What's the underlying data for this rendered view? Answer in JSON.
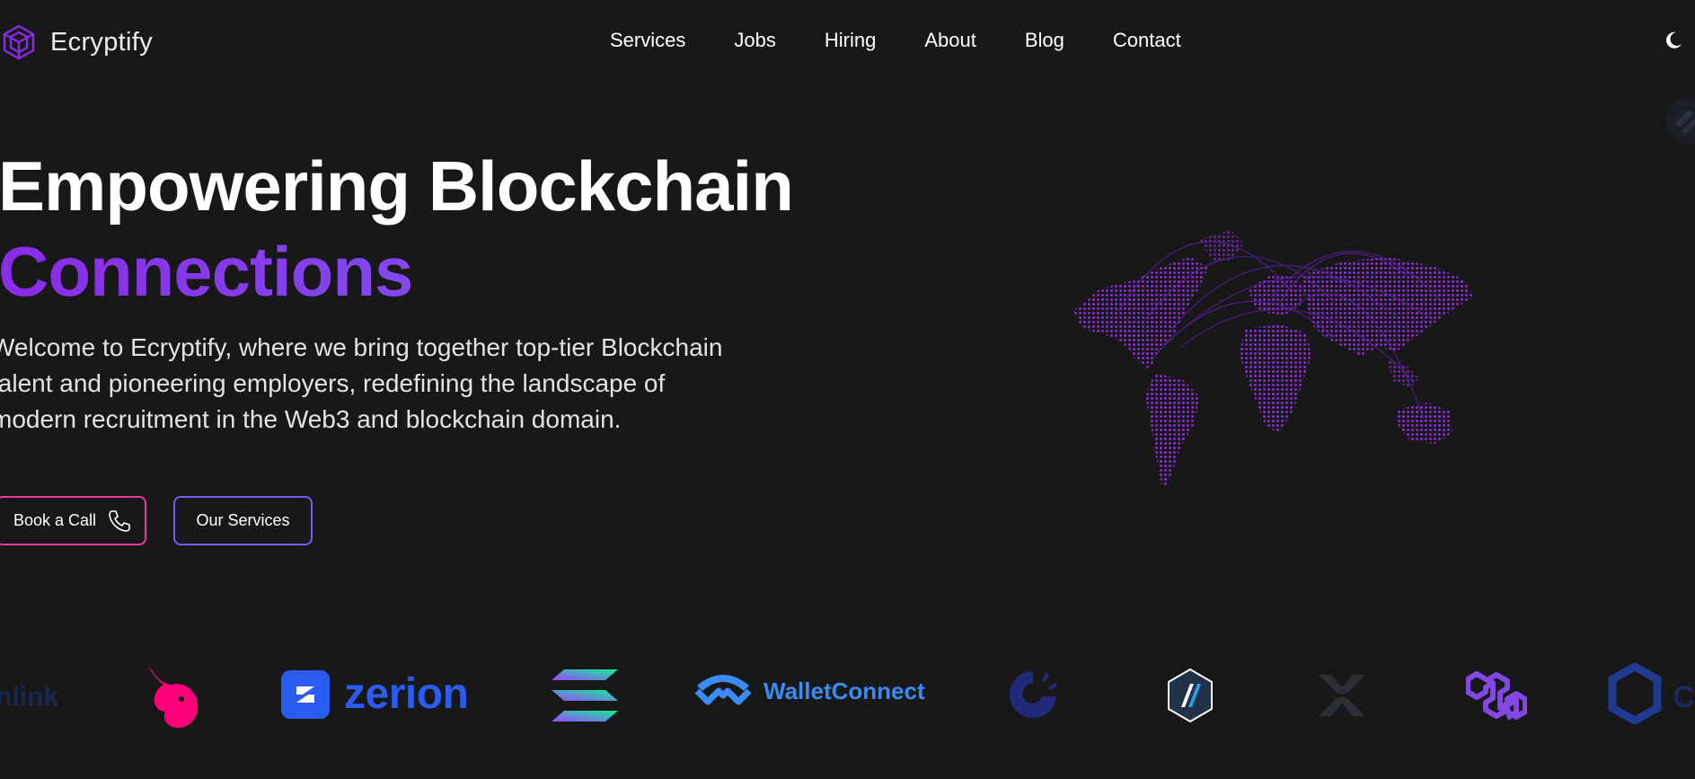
{
  "brand": {
    "name": "Ecryptify",
    "logo_icon": "hex-cube-logo-icon"
  },
  "nav": {
    "items": [
      {
        "label": "Services"
      },
      {
        "label": "Jobs"
      },
      {
        "label": "Hiring"
      },
      {
        "label": "About"
      },
      {
        "label": "Blog"
      },
      {
        "label": "Contact"
      }
    ],
    "theme_toggle_icon": "moon-icon"
  },
  "hero": {
    "title_line1": "Empowering Blockchain",
    "title_line2": "Connections",
    "description": "Welcome to Ecryptify, where we bring together top-tier Blockchain talent and pioneering employers, redefining the landscape of modern recruitment in the Web3 and blockchain domain.",
    "buttons": {
      "book_call": "Book a Call",
      "our_services": "Our Services"
    }
  },
  "logos": {
    "chainlink_partial": "nlink",
    "zerion": "zerion",
    "walletconnect": "WalletConnect",
    "last_partial": "C"
  },
  "colors": {
    "background": "#181819",
    "accent_purple": "#8b2be8",
    "accent_blue": "#7a63f0",
    "button_pink": "#e83a9a",
    "button_blue": "#6e5ef4",
    "map_dots": "#9b2fd8"
  }
}
